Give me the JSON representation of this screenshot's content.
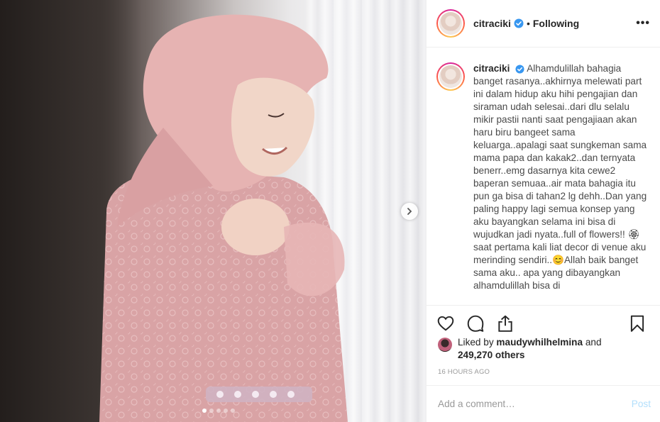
{
  "post": {
    "media_alt": "photo",
    "carousel": {
      "count": 5,
      "active": 0
    }
  },
  "header": {
    "username": "citraciki",
    "separator": "•",
    "follow_status": "Following",
    "more": "•••"
  },
  "caption": {
    "username": "citraciki",
    "text": "Alhamdulillah bahagia banget rasanya..akhirnya melewati part ini dalam hidup aku hihi pengajian dan siraman udah selesai..dari dlu selalu mikir pastii nanti saat pengajiaan akan haru biru bangeet sama keluarga..apalagi saat sungkeman sama mama papa dan kakak2..dan ternyata benerr..emg dasarnya kita cewe2 baperan semuaa..air mata bahagia itu pun ga bisa di tahan2 lg dehh..Dan yang paling happy lagi semua konsep yang aku bayangkan selama ini bisa di wujudkan jadi nyata..full of flowers!! 🏵 saat pertama kali liat decor di venue aku merinding sendiri..😊Allah baik banget sama aku.. apa yang dibayangkan alhamdulillah bisa di"
  },
  "likes": {
    "prefix": "Liked by",
    "user": "maudywhilhelmina",
    "joiner": "and",
    "others": "249,270 others"
  },
  "timestamp": "16 HOURS AGO",
  "comment": {
    "placeholder": "Add a comment…",
    "post_label": "Post"
  },
  "colors": {
    "accent_blue": "#3897f0",
    "post_disabled": "#b2dffc",
    "border": "#efefef"
  }
}
